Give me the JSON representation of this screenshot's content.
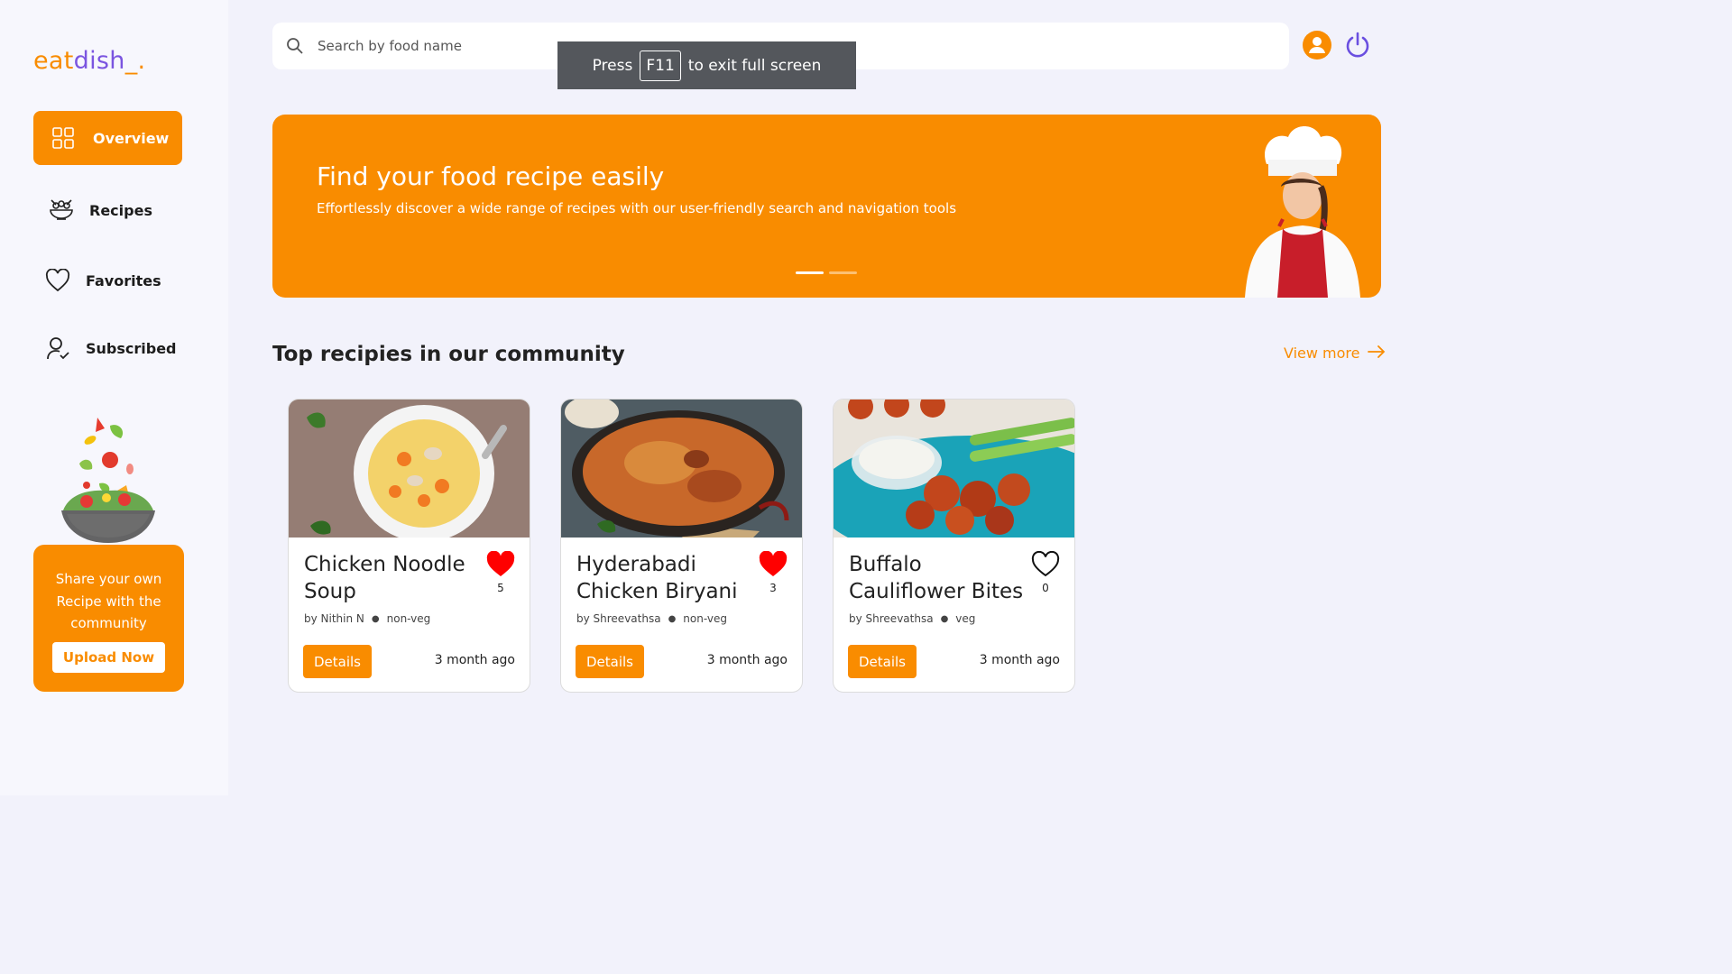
{
  "brand": {
    "part1": "eat",
    "part2": "dish",
    "part3": "_."
  },
  "nav": [
    {
      "label": "Overview"
    },
    {
      "label": "Recipes"
    },
    {
      "label": "Favorites"
    },
    {
      "label": "Subscribed"
    }
  ],
  "promo": {
    "text": "Share your own Recipe with the community",
    "button": "Upload Now"
  },
  "search": {
    "placeholder": "Search by food name",
    "value": ""
  },
  "fullscreen_toast": {
    "prefix": "Press",
    "key": "F11",
    "suffix": "to exit full screen"
  },
  "banner": {
    "title": "Find your food recipe easily",
    "subtitle": "Effortlessly discover a wide range of recipes with our user-friendly search and navigation tools"
  },
  "section": {
    "title": "Top recipies in our community",
    "view_more": "View more"
  },
  "colors": {
    "accent": "#f98c00",
    "brand_purple": "#7b55e0",
    "heart_red": "#ff0000"
  },
  "recipes": [
    {
      "title": "Chicken Noodle Soup",
      "likes": "5",
      "liked": true,
      "author": "by Nithin N",
      "type": "non-veg",
      "button": "Details",
      "age": "3 month ago"
    },
    {
      "title": "Hyderabadi Chicken Biryani",
      "likes": "3",
      "liked": true,
      "author": "by Shreevathsa",
      "type": "non-veg",
      "button": "Details",
      "age": "3 month ago"
    },
    {
      "title": "Buffalo Cauliflower Bites",
      "likes": "0",
      "liked": false,
      "author": "by Shreevathsa",
      "type": "veg",
      "button": "Details",
      "age": "3 month ago"
    }
  ]
}
